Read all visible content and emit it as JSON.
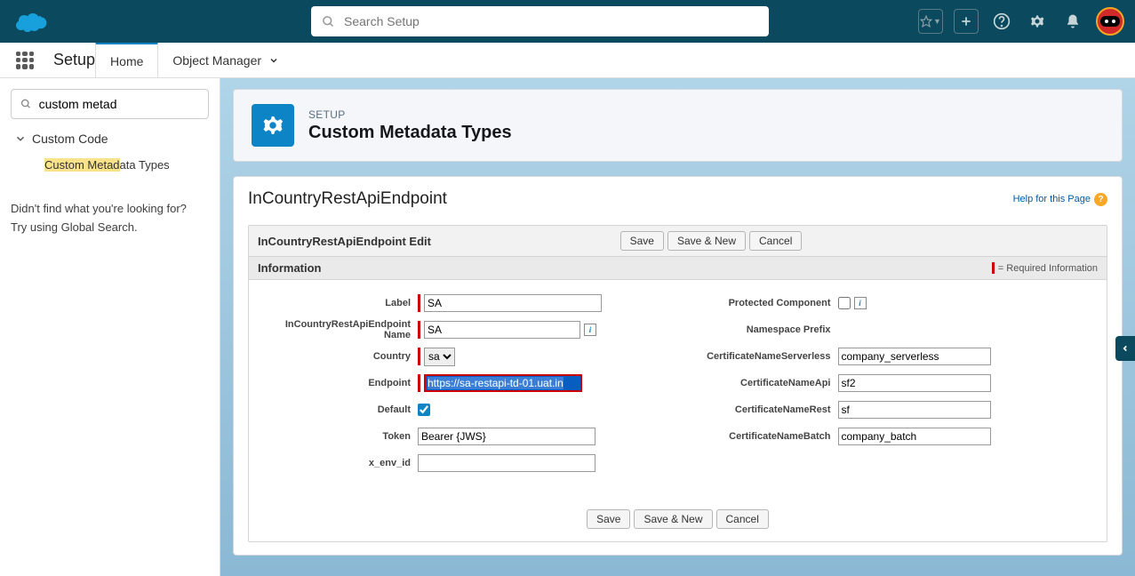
{
  "topbar": {
    "search_placeholder": "Search Setup"
  },
  "nav": {
    "setup_label": "Setup",
    "home": "Home",
    "object_manager": "Object Manager"
  },
  "sidebar": {
    "search_value": "custom metad",
    "node_custom_code": "Custom Code",
    "child_cmt_hl": "Custom Metad",
    "child_cmt_rest": "ata Types",
    "no_results_line1": "Didn't find what you're looking for?",
    "no_results_line2": "Try using Global Search."
  },
  "header": {
    "crumb": "SETUP",
    "title": "Custom Metadata Types"
  },
  "page": {
    "title": "InCountryRestApiEndpoint",
    "help_link": "Help for this Page"
  },
  "edit": {
    "panel_title": "InCountryRestApiEndpoint Edit",
    "btn_save": "Save",
    "btn_save_new": "Save & New",
    "btn_cancel": "Cancel",
    "section_info": "Information",
    "required_note": "= Required Information"
  },
  "fields_left": {
    "label_lbl": "Label",
    "label_val": "SA",
    "name_lbl": "InCountryRestApiEndpoint Name",
    "name_val": "SA",
    "country_lbl": "Country",
    "country_val": "sa",
    "endpoint_lbl": "Endpoint",
    "endpoint_val": "https://sa-restapi-td-01.uat.in",
    "default_lbl": "Default",
    "token_lbl": "Token",
    "token_val": "Bearer {JWS}",
    "xenv_lbl": "x_env_id",
    "xenv_val": ""
  },
  "fields_right": {
    "protected_lbl": "Protected Component",
    "ns_lbl": "Namespace Prefix",
    "cert_serverless_lbl": "CertificateNameServerless",
    "cert_serverless_val": "company_serverless",
    "cert_api_lbl": "CertificateNameApi",
    "cert_api_val": "sf2",
    "cert_rest_lbl": "CertificateNameRest",
    "cert_rest_val": "sf",
    "cert_batch_lbl": "CertificateNameBatch",
    "cert_batch_val": "company_batch"
  }
}
